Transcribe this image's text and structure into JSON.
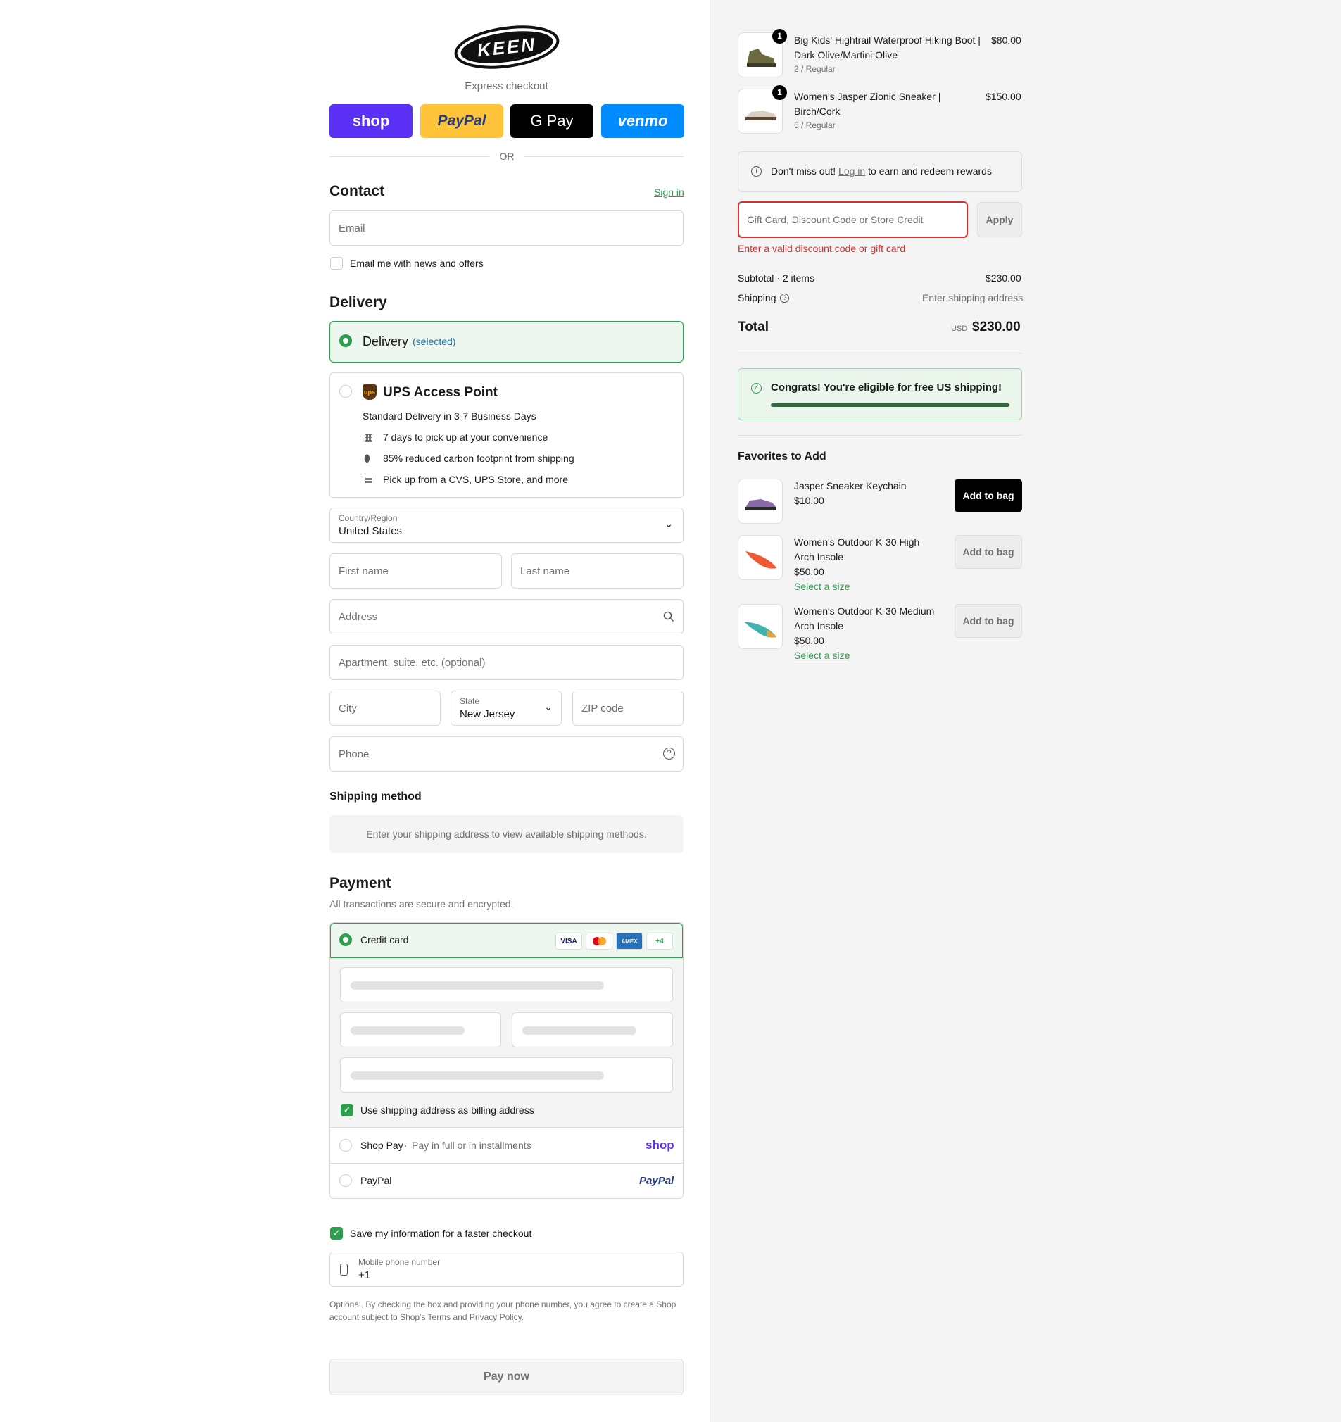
{
  "brand": {
    "logo_text": "KEEN"
  },
  "express": {
    "label": "Express checkout",
    "buttons": [
      {
        "label": "shop",
        "color": "#5a31f4"
      },
      {
        "label": "PayPal",
        "color": "#ffc439"
      },
      {
        "label": "G Pay",
        "color": "#000000"
      },
      {
        "label": "venmo",
        "color": "#008cff"
      }
    ],
    "or": "OR"
  },
  "contact": {
    "title": "Contact",
    "sign_in": "Sign in",
    "email_placeholder": "Email",
    "newsletter": "Email me with news and offers"
  },
  "delivery": {
    "title": "Delivery",
    "option_delivery": "Delivery",
    "option_delivery_state": "(selected)",
    "ups_title": "UPS Access Point",
    "ups_sub": "Standard Delivery in 3-7 Business Days",
    "ups_features": [
      "7 days to pick up at your convenience",
      "85% reduced carbon footprint from shipping",
      "Pick up from a CVS, UPS Store, and more"
    ],
    "country_label": "Country/Region",
    "country_value": "United States",
    "first_name": "First name",
    "last_name": "Last name",
    "address": "Address",
    "apartment": "Apartment, suite, etc. (optional)",
    "city": "City",
    "state_label": "State",
    "state_value": "New Jersey",
    "zip": "ZIP code",
    "phone": "Phone"
  },
  "shipping_method": {
    "title": "Shipping method",
    "notice": "Enter your shipping address to view available shipping methods."
  },
  "payment": {
    "title": "Payment",
    "subtitle": "All transactions are secure and encrypted.",
    "credit_card": "Credit card",
    "card_logos": [
      "VISA",
      "MC",
      "AMEX",
      "+4"
    ],
    "billing_same": "Use shipping address as billing address",
    "shop_pay": "Shop Pay",
    "shop_pay_sub": "Pay in full or in installments",
    "shop_pay_logo": "shop",
    "paypal": "PayPal",
    "paypal_logo": "PayPal"
  },
  "remember": {
    "save_info": "Save my information for a faster checkout",
    "mobile_label": "Mobile phone number",
    "mobile_value": "+1",
    "legal_1": "Optional. By checking the box and providing your phone number, you agree to create a Shop",
    "legal_2": "account subject to Shop's",
    "terms": "Terms",
    "and": "and",
    "privacy": "Privacy Policy",
    "period": "."
  },
  "pay_now": "Pay now",
  "cart": {
    "items": [
      {
        "qty": "1",
        "name_1": "Big Kids' Hightrail Waterproof Hiking Boot |",
        "name_2": "Dark Olive/Martini Olive",
        "variant": "2 / Regular",
        "price": "$80.00"
      },
      {
        "qty": "1",
        "name_1": "Women's Jasper Zionic Sneaker |",
        "name_2": "Birch/Cork",
        "variant": "5 / Regular",
        "price": "$150.00"
      }
    ],
    "rewards_prefix": "Don't miss out!",
    "rewards_link": "Log in",
    "rewards_suffix": "to earn and redeem rewards",
    "discount_placeholder": "Gift Card, Discount Code or Store Credit",
    "apply": "Apply",
    "discount_error": "Enter a valid discount code or gift card",
    "subtotal_label": "Subtotal · 2 items",
    "subtotal_value": "$230.00",
    "shipping_label": "Shipping",
    "shipping_value": "Enter shipping address",
    "total_label": "Total",
    "currency": "USD",
    "total_value": "$230.00",
    "free_shipping": "Congrats! You're eligible for free US shipping!",
    "free_shipping_progress": 1.0
  },
  "favorites": {
    "title": "Favorites to Add",
    "items": [
      {
        "name_1": "Jasper Sneaker Keychain",
        "name_2": "",
        "price": "$10.00",
        "select": "",
        "button": "Add to bag"
      },
      {
        "name_1": "Women's Outdoor K-30 High",
        "name_2": "Arch Insole",
        "price": "$50.00",
        "select": "Select a size",
        "button": "Add to bag"
      },
      {
        "name_1": "Women's Outdoor K-30 Medium",
        "name_2": "Arch Insole",
        "price": "$50.00",
        "select": "Select a size",
        "button": "Add to bag"
      }
    ]
  },
  "colors": {
    "accent_green": "#2e9e4f",
    "error_red": "#d92c2c",
    "link_blue": "#1773b0"
  }
}
